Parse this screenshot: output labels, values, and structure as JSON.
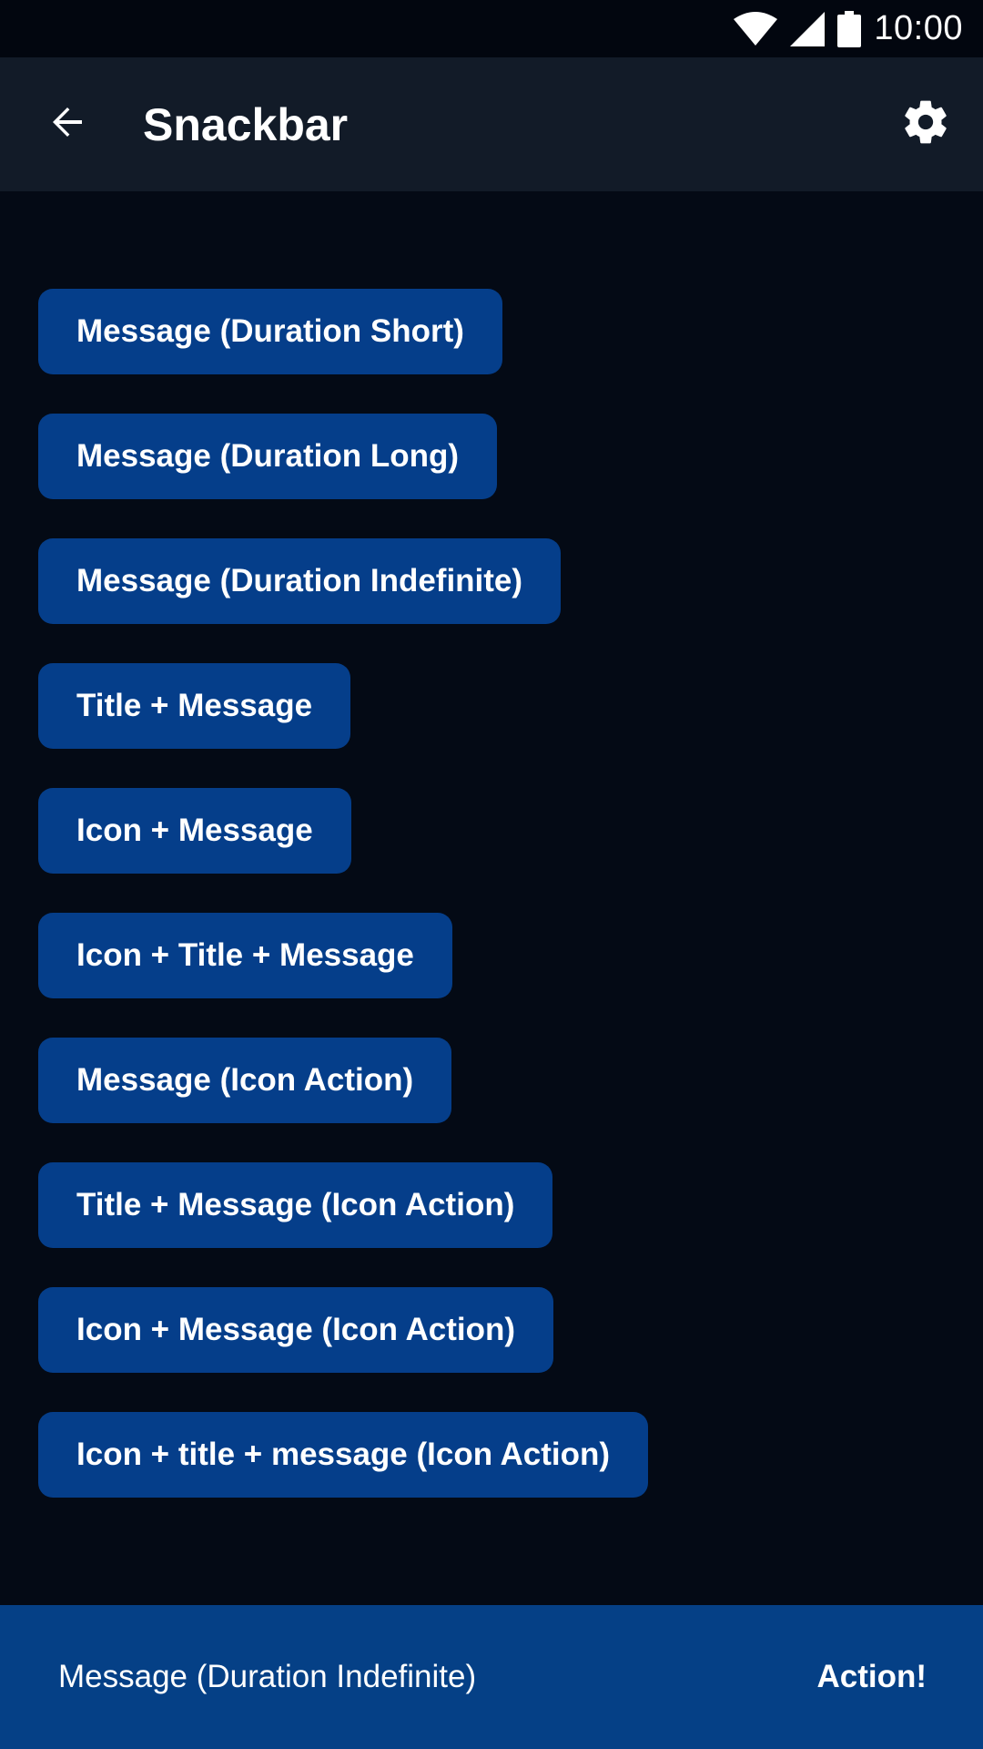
{
  "status_bar": {
    "time": "10:00",
    "icons": [
      "wifi-icon",
      "cellular-signal-icon",
      "battery-icon"
    ]
  },
  "app_bar": {
    "title": "Snackbar",
    "back_icon": "arrow-back-icon",
    "settings_icon": "gear-icon"
  },
  "buttons": [
    {
      "label": "Message (Duration Short)"
    },
    {
      "label": "Message (Duration Long)"
    },
    {
      "label": "Message (Duration Indefinite)"
    },
    {
      "label": "Title + Message"
    },
    {
      "label": "Icon + Message"
    },
    {
      "label": "Icon + Title + Message"
    },
    {
      "label": "Message (Icon Action)"
    },
    {
      "label": "Title + Message (Icon Action)"
    },
    {
      "label": "Icon + Message (Icon Action)"
    },
    {
      "label": "Icon + title + message (Icon Action)"
    }
  ],
  "snackbar": {
    "message": "Message (Duration Indefinite)",
    "action_label": "Action!"
  },
  "colors": {
    "background": "#040a15",
    "status_bar": "#02060f",
    "app_bar": "#121b28",
    "button": "#053e8a",
    "snackbar": "#054086",
    "text": "#ffffff"
  }
}
